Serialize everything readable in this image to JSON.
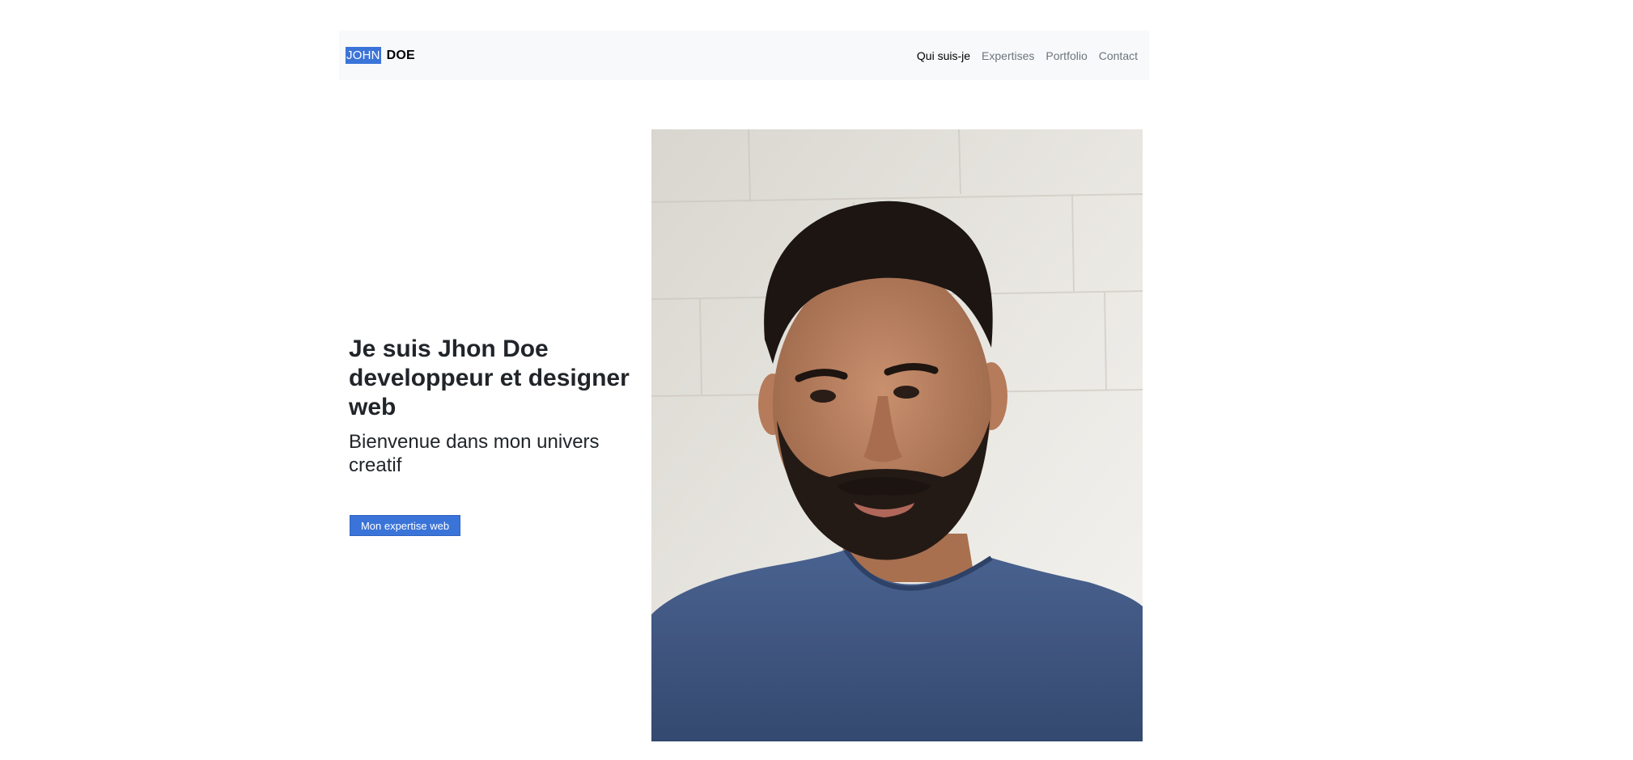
{
  "brand": {
    "first": "JOHN",
    "last": "DOE"
  },
  "nav": {
    "items": [
      {
        "label": "Qui suis-je",
        "active": true
      },
      {
        "label": "Expertises",
        "active": false
      },
      {
        "label": "Portfolio",
        "active": false
      },
      {
        "label": "Contact",
        "active": false
      }
    ]
  },
  "hero": {
    "title": "Je suis Jhon Doe developpeur et designer web",
    "subtitle": "Bienvenue dans mon univers creatif",
    "button_label": "Mon expertise web"
  },
  "colors": {
    "accent": "#3b74d8",
    "navbar_bg": "#f8f9fa",
    "shirt": "#3f5680"
  },
  "image": {
    "subject": "portrait-photo"
  }
}
